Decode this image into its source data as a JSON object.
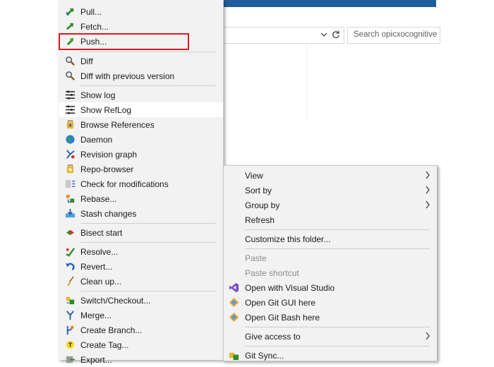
{
  "explorer": {
    "search_placeholder": "Search opicxocognitive"
  },
  "left_menu": {
    "pull": "Pull...",
    "fetch": "Fetch...",
    "push": "Push...",
    "diff": "Diff",
    "diff_prev": "Diff with previous version",
    "show_log": "Show log",
    "show_reflog": "Show RefLog",
    "browse_references": "Browse References",
    "daemon": "Daemon",
    "revision_graph": "Revision graph",
    "repo_browser": "Repo-browser",
    "check_modifications": "Check for modifications",
    "rebase": "Rebase...",
    "stash_changes": "Stash changes",
    "bisect_start": "Bisect start",
    "resolve": "Resolve...",
    "revert": "Revert...",
    "clean_up": "Clean up...",
    "switch_checkout": "Switch/Checkout...",
    "merge": "Merge...",
    "create_branch": "Create Branch...",
    "create_tag": "Create Tag...",
    "export": "Export..."
  },
  "right_menu": {
    "view": "View",
    "sort_by": "Sort by",
    "group_by": "Group by",
    "refresh": "Refresh",
    "customize_folder": "Customize this folder...",
    "paste": "Paste",
    "paste_shortcut": "Paste shortcut",
    "open_vs": "Open with Visual Studio",
    "open_git_gui": "Open Git GUI here",
    "open_git_bash": "Open Git Bash here",
    "give_access": "Give access to",
    "git_sync": "Git Sync..."
  },
  "icons": {
    "pull": "pull-icon",
    "fetch": "fetch-icon",
    "push": "push-icon",
    "diff": "magnifier-icon",
    "log": "log-icon",
    "references": "references-icon",
    "daemon": "globe-icon",
    "revision_graph": "graph-icon",
    "repo_browser": "repo-browser-icon",
    "check_modifications": "check-modifications-icon",
    "rebase": "rebase-icon",
    "stash": "stash-icon",
    "bisect": "bisect-icon",
    "resolve": "resolve-icon",
    "revert": "revert-icon",
    "clean_up": "broom-icon",
    "switch": "switch-icon",
    "merge": "merge-icon",
    "branch": "branch-icon",
    "tag": "tag-icon",
    "visual_studio": "visual-studio-icon",
    "git": "git-icon",
    "chevron": "chevron-right-icon"
  },
  "colors": {
    "highlight_border": "#e0171f",
    "menu_background": "#f2f2f2",
    "title_bar": "#1f5c9a"
  }
}
